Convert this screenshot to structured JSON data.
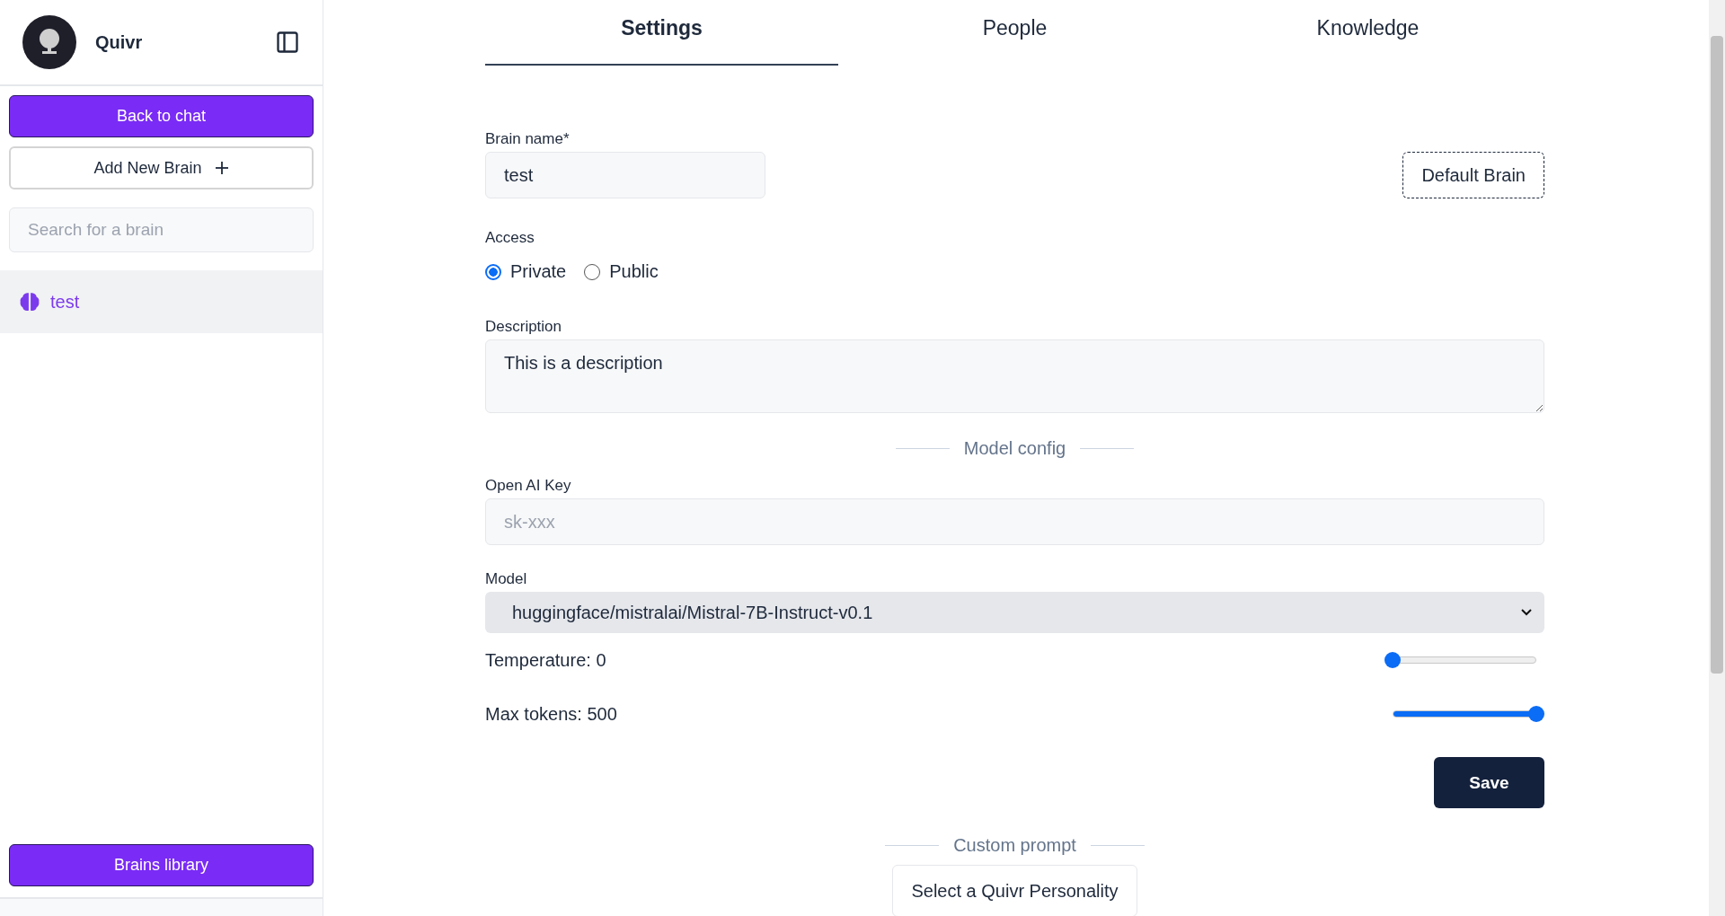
{
  "sidebar": {
    "app_name": "Quivr",
    "back_button": "Back to chat",
    "add_button": "Add New Brain",
    "search": {
      "placeholder": "Search for a brain"
    },
    "brains": [
      {
        "name": "test",
        "selected": true
      }
    ],
    "library_button": "Brains library"
  },
  "tabs": [
    {
      "label": "Settings",
      "selected": true
    },
    {
      "label": "People",
      "selected": false
    },
    {
      "label": "Knowledge",
      "selected": false
    }
  ],
  "settings": {
    "brain_name": {
      "label": "Brain name*",
      "value": "test"
    },
    "default_button": "Default Brain",
    "access": {
      "label": "Access",
      "options": [
        {
          "label": "Private",
          "selected": true
        },
        {
          "label": "Public",
          "selected": false
        }
      ]
    },
    "description": {
      "label": "Description",
      "value": "This is a description"
    },
    "model_config_heading": "Model config",
    "openai_key": {
      "label": "Open AI Key",
      "placeholder": "sk-xxx"
    },
    "model": {
      "label": "Model",
      "value": "huggingface/mistralai/Mistral-7B-Instruct-v0.1"
    },
    "sliders": [
      {
        "label": "Temperature: 0",
        "level": 0
      },
      {
        "label": "Max tokens: 500",
        "level": 1
      }
    ],
    "save_button": "Save",
    "custom_prompt_heading": "Custom prompt",
    "personality_button": "Select a Quivr Personality"
  }
}
